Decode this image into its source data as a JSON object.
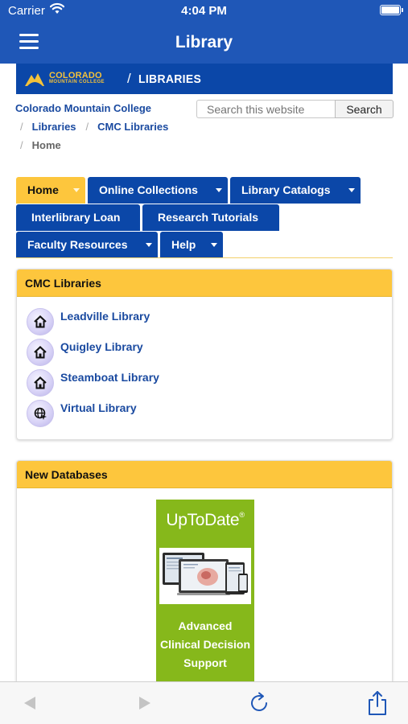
{
  "status_bar": {
    "carrier": "Carrier",
    "time": "4:04 PM"
  },
  "app": {
    "title": "Library"
  },
  "banner": {
    "college_name": "COLORADO",
    "college_sub": "MOUNTAIN COLLEGE",
    "separator": "/",
    "section": "LIBRARIES"
  },
  "breadcrumb": {
    "root": "Colorado Mountain College",
    "separator": "/",
    "items": [
      "Libraries",
      "CMC Libraries"
    ],
    "current": "Home"
  },
  "search": {
    "placeholder": "Search this website",
    "button_label": "Search"
  },
  "nav_tabs": [
    {
      "label": "Home",
      "active": true,
      "has_menu": true
    },
    {
      "label": "Online Collections",
      "active": false,
      "has_menu": true
    },
    {
      "label": "Library Catalogs",
      "active": false,
      "has_menu": true
    },
    {
      "label": "Interlibrary Loan",
      "active": false,
      "has_menu": false
    },
    {
      "label": "Research Tutorials",
      "active": false,
      "has_menu": false
    },
    {
      "label": "Faculty Resources",
      "active": false,
      "has_menu": true
    },
    {
      "label": "Help",
      "active": false,
      "has_menu": true
    }
  ],
  "cmc_panel": {
    "title": "CMC Libraries",
    "items": [
      {
        "label": "Leadville Library",
        "icon": "home-icon"
      },
      {
        "label": "Quigley Library",
        "icon": "home-icon"
      },
      {
        "label": "Steamboat Library",
        "icon": "home-icon"
      },
      {
        "label": "Virtual Library",
        "icon": "globe-icon"
      }
    ]
  },
  "databases_panel": {
    "title": "New Databases",
    "promo": {
      "name": "UpToDate",
      "trademark": "®",
      "caption_lines": [
        "Advanced",
        "Clinical Decision",
        "Support"
      ]
    }
  },
  "colors": {
    "header_blue": "#1f57b7",
    "nav_blue": "#0b47a8",
    "accent_gold": "#fdc63d",
    "link_blue": "#1a4aa0",
    "promo_green": "#86b81b"
  }
}
